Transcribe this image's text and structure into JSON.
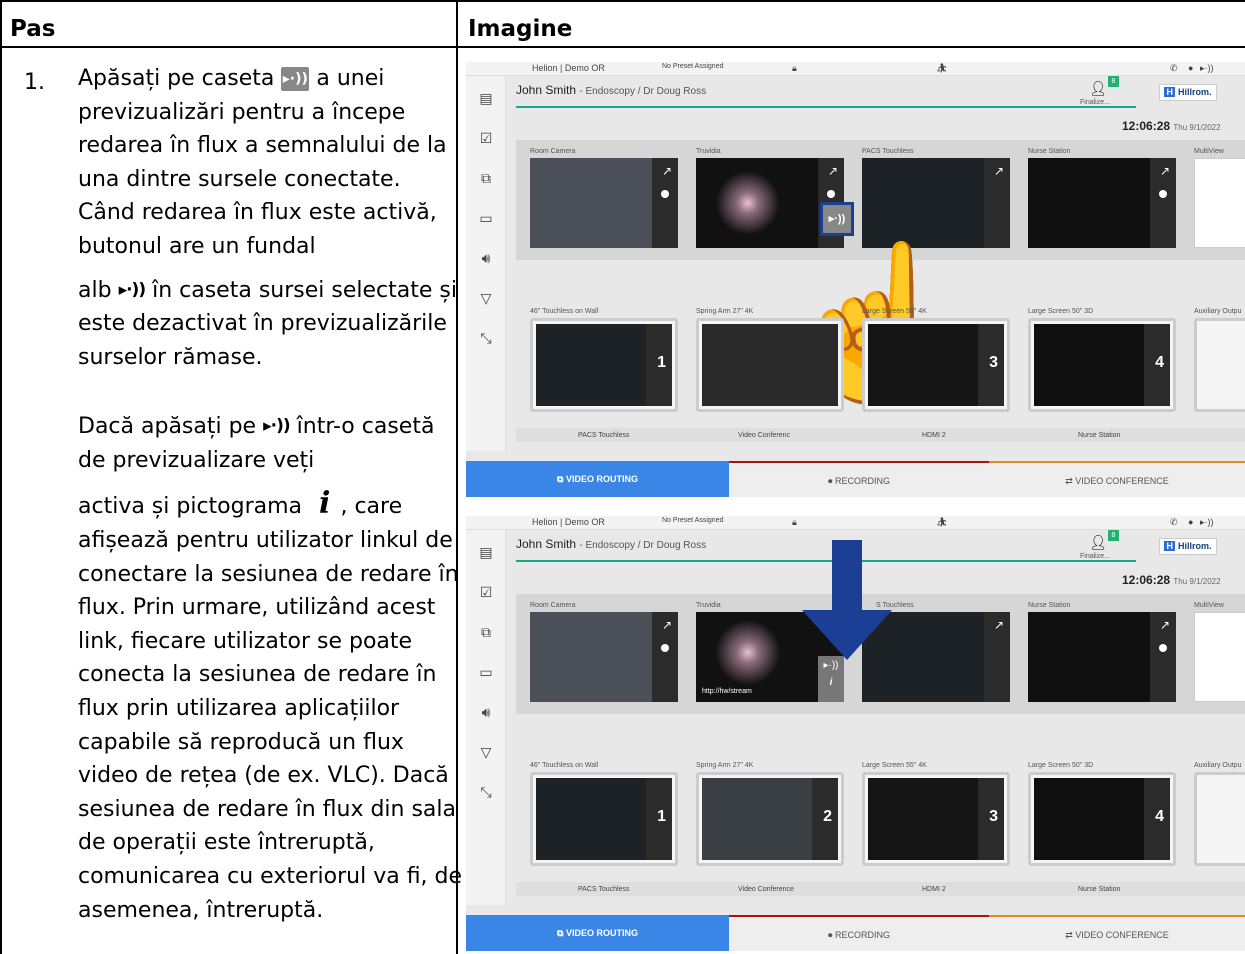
{
  "table": {
    "col_step": "Pas",
    "col_image": "Imagine"
  },
  "step": {
    "number": "1.",
    "p1a": "Apăsați pe caseta",
    "p1b": "a unei previzualizări pentru a începe redarea în flux a semnalului de la una dintre sursele conectate. Când redarea în flux este activă, butonul are un fundal",
    "p1c": "alb",
    "p1d": "în caseta sursei selectate și este dezactivat în previzualizările surselor rămase.",
    "p2a": "Dacă apăsați pe",
    "p2b": "într-o casetă de previzualizare veți",
    "p2c": "activa și pictograma",
    "p2d": ", care afișează pentru utilizator linkul de conectare la sesiunea de redare în flux. Prin urmare, utilizând acest link, fiecare utilizator se poate conecta la sesiunea de redare în flux prin utilizarea aplicațiilor capabile să reproducă un flux video de rețea (de ex. VLC). Dacă sesiunea de redare în flux din sala de operații este întreruptă, comunicarea cu exteriorul va fi, de asemenea, întreruptă."
  },
  "icons": {
    "stream_glyph": "▸·))",
    "info_glyph": "i"
  },
  "ui": {
    "location": "Helion | Demo OR",
    "preset": "No Preset Assigned",
    "patient_name": "John Smith",
    "patient_detail": "- Endoscopy / Dr Doug Ross",
    "finalize": "Finalize...",
    "badge": "8",
    "brand": "Hillrom.",
    "brand_mark": "H",
    "time": "12:06:28",
    "date": "Thu 9/1/2022",
    "sources": [
      "Room Camera",
      "Truvidia",
      "PACS Touchless",
      "Nurse Station",
      "MultiView"
    ],
    "sources_second": [
      "Room Camera",
      "Truvidia",
      "S Touchless",
      "Nurse Station",
      "MultiView"
    ],
    "outputs": [
      "46\" Touchless on Wall",
      "Spring Arm 27\" 4K",
      "Large Screen 55\" 4K",
      "Large Screen 50\" 3D",
      "Auxiliary Outpu"
    ],
    "output_numbers": [
      "1",
      "2",
      "3",
      "4"
    ],
    "assigned": [
      "PACS Touchless",
      "Video Conference",
      "HDMI 2",
      "Nurse Station"
    ],
    "assigned_first": [
      "PACS Touchless",
      "Video Conferenc",
      "HDMI 2",
      "Nurse Station"
    ],
    "tabs": [
      "VIDEO ROUTING",
      "RECORDING",
      "VIDEO CONFERENCE"
    ],
    "stream_url": "http://hw/stream"
  }
}
